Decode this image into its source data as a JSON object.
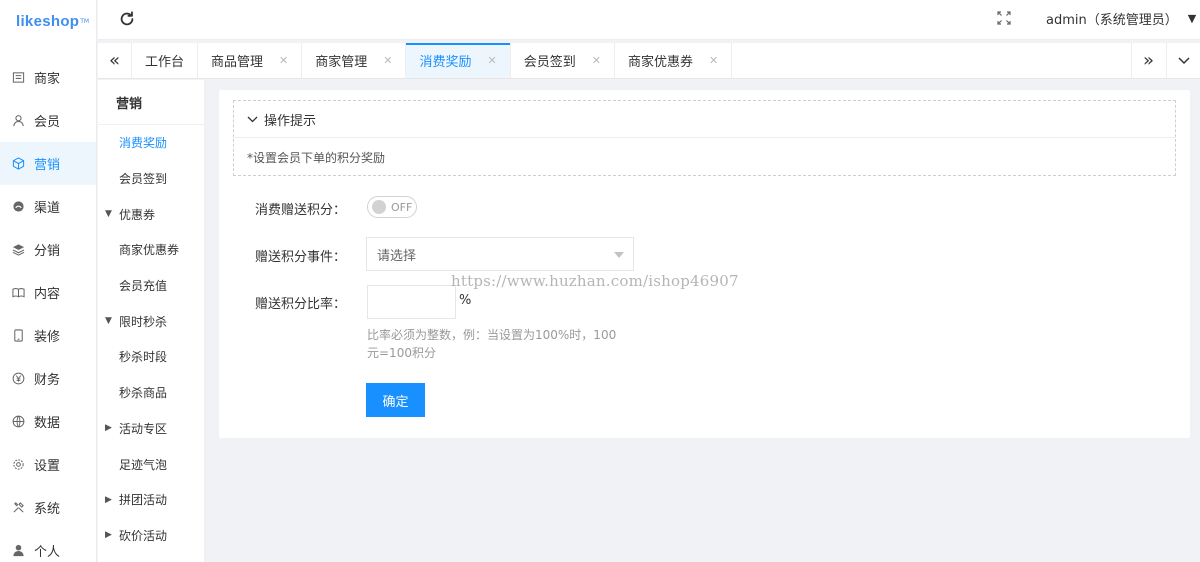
{
  "app": {
    "logo": "likeshop",
    "logo_tm": "TM"
  },
  "rail": [
    {
      "label": "商家",
      "icon": "store-icon"
    },
    {
      "label": "会员",
      "icon": "user-icon"
    },
    {
      "label": "营销",
      "icon": "cube-icon",
      "active": true
    },
    {
      "label": "渠道",
      "icon": "channel-icon"
    },
    {
      "label": "分销",
      "icon": "layers-icon"
    },
    {
      "label": "内容",
      "icon": "book-icon"
    },
    {
      "label": "装修",
      "icon": "tablet-icon"
    },
    {
      "label": "财务",
      "icon": "yen-icon"
    },
    {
      "label": "数据",
      "icon": "globe-icon"
    },
    {
      "label": "设置",
      "icon": "gear-icon"
    },
    {
      "label": "系统",
      "icon": "tools-icon"
    },
    {
      "label": "个人",
      "icon": "person-icon"
    }
  ],
  "header": {
    "user": "admin（系统管理员）"
  },
  "tabs": [
    {
      "label": "工作台",
      "closable": false
    },
    {
      "label": "商品管理",
      "closable": true
    },
    {
      "label": "商家管理",
      "closable": true
    },
    {
      "label": "消费奖励",
      "closable": true,
      "active": true
    },
    {
      "label": "会员签到",
      "closable": true
    },
    {
      "label": "商家优惠券",
      "closable": true
    }
  ],
  "submenu": {
    "title": "营销",
    "items": [
      {
        "label": "消费奖励",
        "active": true
      },
      {
        "label": "会员签到"
      },
      {
        "label": "优惠券",
        "group": "expanded"
      },
      {
        "label": "商家优惠券"
      },
      {
        "label": "会员充值"
      },
      {
        "label": "限时秒杀",
        "group": "expanded"
      },
      {
        "label": "秒杀时段"
      },
      {
        "label": "秒杀商品"
      },
      {
        "label": "活动专区",
        "group": "collapsed"
      },
      {
        "label": "足迹气泡"
      },
      {
        "label": "拼团活动",
        "group": "collapsed"
      },
      {
        "label": "砍价活动",
        "group": "collapsed"
      }
    ]
  },
  "tips": {
    "title": "操作提示",
    "text": "*设置会员下单的积分奖励"
  },
  "form": {
    "gift_points_label": "消费赠送积分：",
    "switch_state": "OFF",
    "event_label": "赠送积分事件：",
    "event_placeholder": "请选择",
    "ratio_label": "赠送积分比率：",
    "ratio_value": "",
    "ratio_unit": "%",
    "ratio_hint": "比率必须为整数，例：当设置为100%时，100元=100积分",
    "submit": "确定"
  },
  "watermark": "https://www.huzhan.com/ishop46907",
  "colors": {
    "accent": "#1890ff",
    "logo": "#3f8ef0"
  }
}
